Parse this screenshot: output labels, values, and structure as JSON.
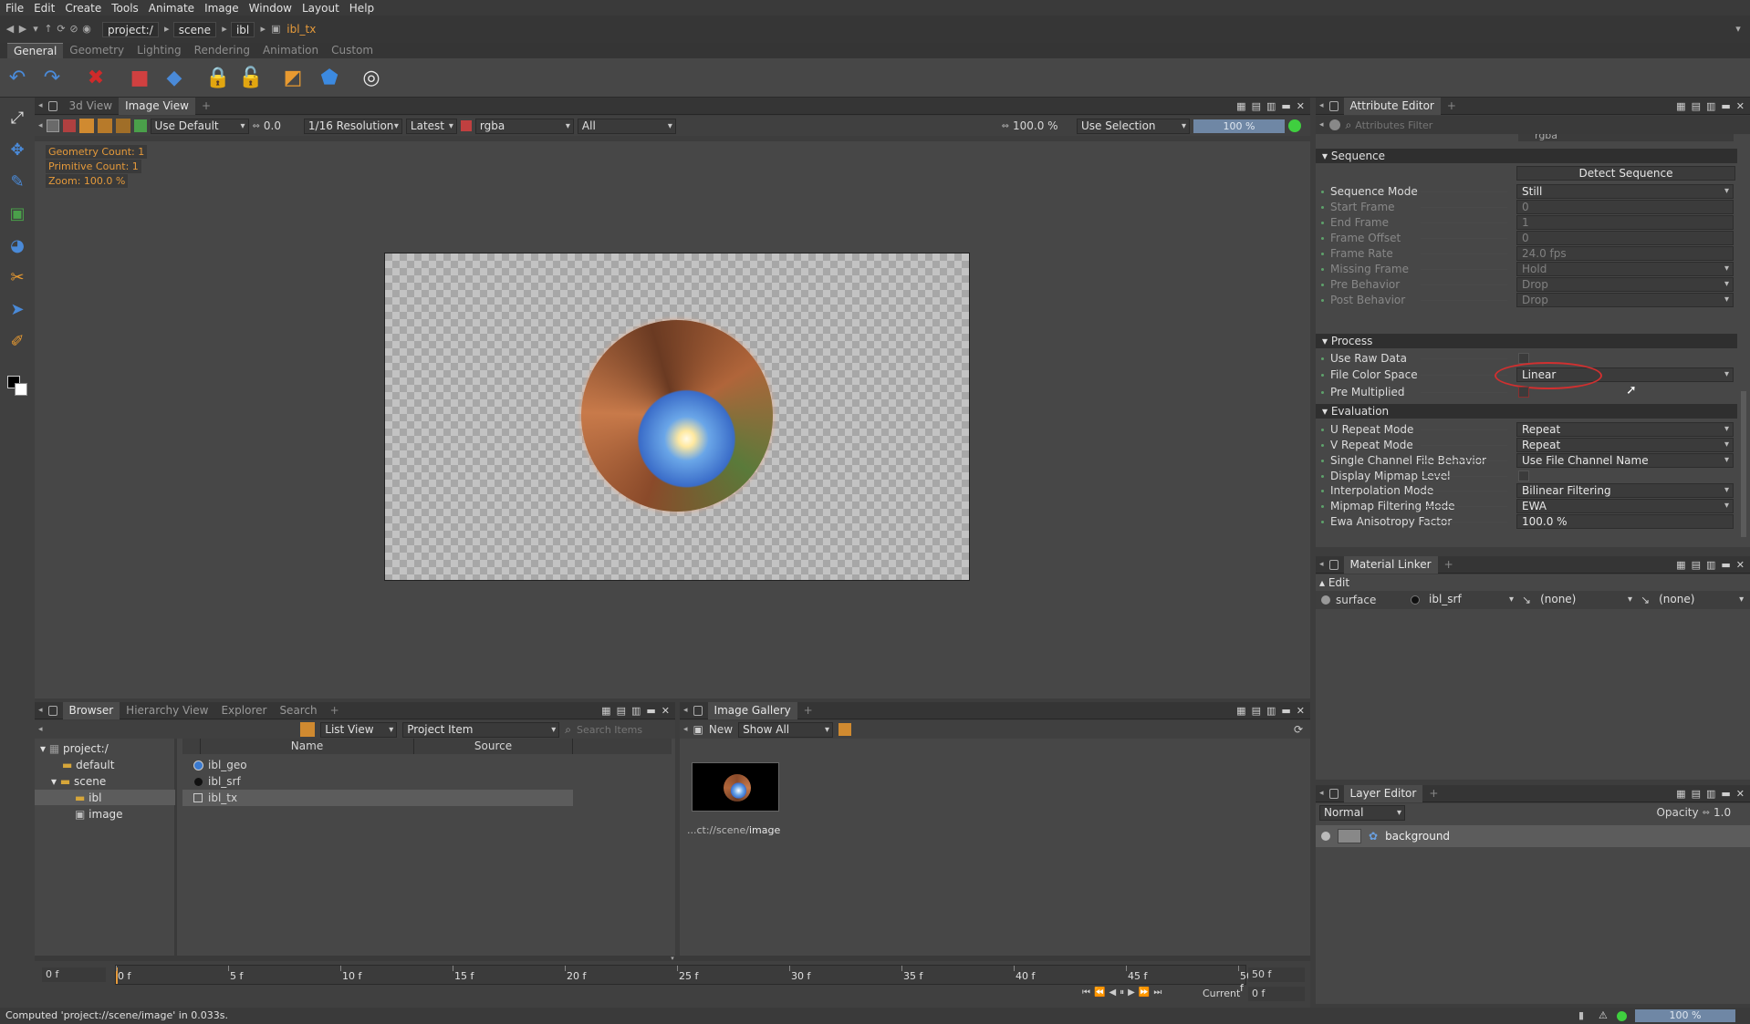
{
  "menu": [
    "File",
    "Edit",
    "Create",
    "Tools",
    "Animate",
    "Image",
    "Window",
    "Layout",
    "Help"
  ],
  "breadcrumb": [
    "project:/",
    "scene",
    "ibl",
    "ibl_tx"
  ],
  "shelf_tabs": [
    "General",
    "Geometry",
    "Lighting",
    "Rendering",
    "Animation",
    "Custom"
  ],
  "viewer": {
    "tabs": [
      "3d View",
      "Image View"
    ],
    "use_default": "Use Default",
    "exposure": "0.0",
    "resolution": "1/16 Resolution",
    "version": "Latest",
    "channel": "rgba",
    "all": "All",
    "zoom_field": "100.0 %",
    "use_selection": "Use Selection",
    "zoom_bar": "100 %",
    "overlay": [
      "Geometry Count: 1",
      "Primitive Count: 1",
      "Zoom: 100.0 %"
    ]
  },
  "attr_editor": {
    "title": "Attribute Editor",
    "filter_placeholder": "Attributes Filter",
    "top_value": "rgba",
    "sequence_label": "Sequence",
    "detect_button": "Detect Sequence",
    "sequence_rows": [
      {
        "label": "Sequence Mode",
        "value": "Still",
        "dim": false,
        "dd": true
      },
      {
        "label": "Start Frame",
        "value": "0",
        "dim": true,
        "dd": false
      },
      {
        "label": "End Frame",
        "value": "1",
        "dim": true,
        "dd": false
      },
      {
        "label": "Frame Offset",
        "value": "0",
        "dim": true,
        "dd": false
      },
      {
        "label": "Frame Rate",
        "value": "24.0 fps",
        "dim": true,
        "dd": false
      },
      {
        "label": "Missing Frame",
        "value": "Hold",
        "dim": true,
        "dd": true
      },
      {
        "label": "Pre Behavior",
        "value": "Drop",
        "dim": true,
        "dd": true
      },
      {
        "label": "Post Behavior",
        "value": "Drop",
        "dim": true,
        "dd": true
      }
    ],
    "process_label": "Process",
    "use_raw_data": "Use Raw Data",
    "file_color_space": "File Color Space",
    "file_color_space_value": "Linear",
    "pre_multiplied": "Pre Multiplied",
    "evaluation_label": "Evaluation",
    "evaluation_rows": [
      {
        "label": "U Repeat Mode",
        "value": "Repeat"
      },
      {
        "label": "V Repeat Mode",
        "value": "Repeat"
      },
      {
        "label": "Single Channel File Behavior",
        "value": "Use File Channel Name"
      },
      {
        "label": "Display Mipmap Level",
        "value": ""
      },
      {
        "label": "Interpolation Mode",
        "value": "Bilinear Filtering"
      },
      {
        "label": "Mipmap Filtering Mode",
        "value": "EWA"
      },
      {
        "label": "Ewa Anisotropy Factor",
        "value": "100.0 %"
      }
    ]
  },
  "material_linker": {
    "title": "Material Linker",
    "edit": "Edit",
    "surface": "surface",
    "material": "ibl_srf",
    "none1": "(none)",
    "none2": "(none)"
  },
  "layer_editor": {
    "title": "Layer Editor",
    "blend": "Normal",
    "opacity_label": "Opacity",
    "opacity": "1.0",
    "layer": "background"
  },
  "browser": {
    "tabs": [
      "Browser",
      "Hierarchy View",
      "Explorer",
      "Search"
    ],
    "view_mode": "List View",
    "filter": "Project Item",
    "search_placeholder": "Search Items",
    "tree": [
      "project:/",
      "default",
      "scene",
      "ibl",
      "image"
    ],
    "columns": [
      "Name",
      "Source"
    ],
    "items": [
      "ibl_geo",
      "ibl_srf",
      "ibl_tx"
    ]
  },
  "gallery": {
    "title": "Image Gallery",
    "new": "New",
    "show": "Show All",
    "caption_prefix": "...ct://scene/",
    "caption_name": "image"
  },
  "timeline": {
    "start": "0 f",
    "ticks": [
      "0 f",
      "5 f",
      "10 f",
      "15 f",
      "20 f",
      "25 f",
      "30 f",
      "35 f",
      "40 f",
      "45 f",
      "50 f"
    ],
    "end": "50 f",
    "current_label": "Current",
    "current": "0 f"
  },
  "status": {
    "message": "Computed 'project://scene/image' in 0.033s.",
    "zoom": "100 %"
  },
  "colors": {
    "accent": "#e59a3b",
    "highlight": "#d03030",
    "ok": "#3fcf3f"
  }
}
